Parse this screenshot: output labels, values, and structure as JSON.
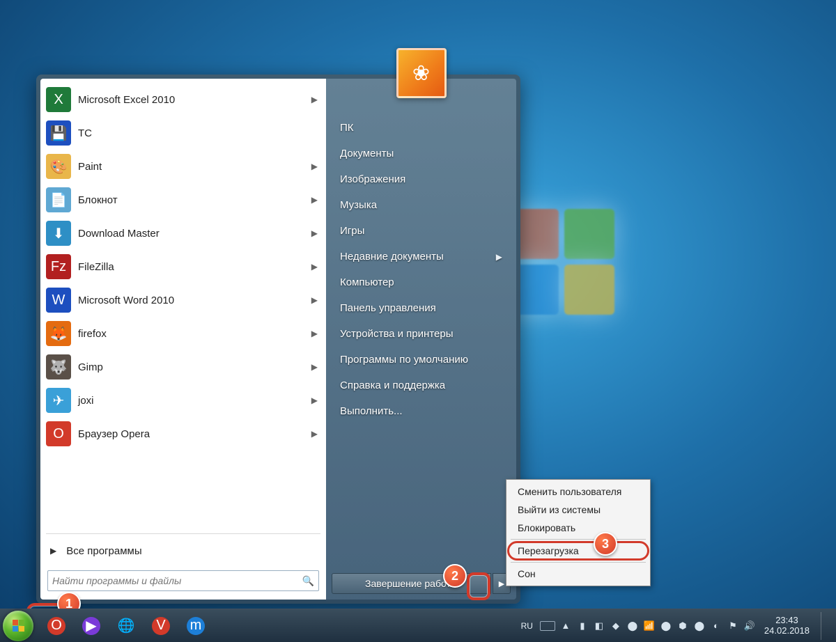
{
  "programs": [
    {
      "label": "Microsoft Excel 2010",
      "icon_bg": "#1f7a3a",
      "glyph": "X",
      "arrow": true
    },
    {
      "label": "TC",
      "icon_bg": "#1d4fbf",
      "glyph": "💾",
      "arrow": false
    },
    {
      "label": "Paint",
      "icon_bg": "#e9b64a",
      "glyph": "🎨",
      "arrow": true
    },
    {
      "label": "Блокнот",
      "icon_bg": "#5fa8d3",
      "glyph": "📄",
      "arrow": true
    },
    {
      "label": "Download Master",
      "icon_bg": "#2e8fc5",
      "glyph": "⬇",
      "arrow": true
    },
    {
      "label": "FileZilla",
      "icon_bg": "#b22020",
      "glyph": "Fz",
      "arrow": true
    },
    {
      "label": "Microsoft Word 2010",
      "icon_bg": "#1d4fbf",
      "glyph": "W",
      "arrow": true
    },
    {
      "label": "firefox",
      "icon_bg": "#e46b10",
      "glyph": "🦊",
      "arrow": true
    },
    {
      "label": "Gimp",
      "icon_bg": "#5a5048",
      "glyph": "🐺",
      "arrow": true
    },
    {
      "label": "joxi",
      "icon_bg": "#3aa0d8",
      "glyph": "✈",
      "arrow": true
    },
    {
      "label": "Браузер Opera",
      "icon_bg": "#d23a2a",
      "glyph": "O",
      "arrow": true
    }
  ],
  "all_programs_label": "Все программы",
  "search_placeholder": "Найти программы и файлы",
  "right_links": [
    {
      "label": "ПК",
      "arrow": false
    },
    {
      "label": "Документы",
      "arrow": false
    },
    {
      "label": "Изображения",
      "arrow": false
    },
    {
      "label": "Музыка",
      "arrow": false
    },
    {
      "label": "Игры",
      "arrow": false
    },
    {
      "label": "Недавние документы",
      "arrow": true
    },
    {
      "label": "Компьютер",
      "arrow": false
    },
    {
      "label": "Панель управления",
      "arrow": false
    },
    {
      "label": "Устройства и принтеры",
      "arrow": false
    },
    {
      "label": "Программы по умолчанию",
      "arrow": false
    },
    {
      "label": "Справка и поддержка",
      "arrow": false
    },
    {
      "label": "Выполнить...",
      "arrow": false
    }
  ],
  "shutdown_label": "Завершение работы",
  "submenu": [
    "Сменить пользователя",
    "Выйти из системы",
    "Блокировать",
    "Перезагрузка",
    "Сон"
  ],
  "submenu_highlight_index": 3,
  "taskbar_pins": [
    {
      "name": "opera",
      "bg": "#d23a2a",
      "glyph": "O"
    },
    {
      "name": "media",
      "bg": "#7a3bd8",
      "glyph": "▶"
    },
    {
      "name": "chrome",
      "bg": "",
      "glyph": "🌐"
    },
    {
      "name": "vivaldi",
      "bg": "#d23a2a",
      "glyph": "V"
    },
    {
      "name": "maxthon",
      "bg": "#1d7fd8",
      "glyph": "m"
    }
  ],
  "language_indicator": "RU",
  "clock_time": "23:43",
  "clock_date": "24.02.2018",
  "annotations": {
    "b1": "1",
    "b2": "2",
    "b3": "3"
  }
}
